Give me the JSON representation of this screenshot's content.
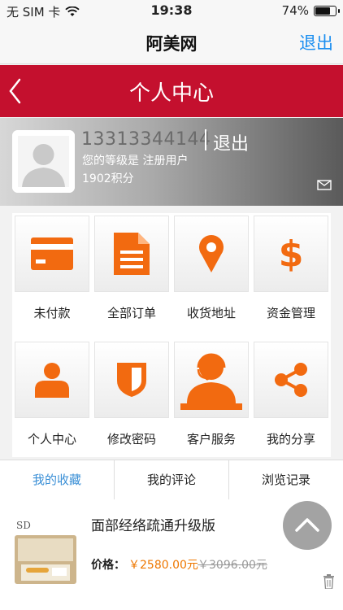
{
  "status_bar": {
    "carrier": "无 SIM 卡",
    "wifi_icon": "wifi-icon",
    "time": "19:38",
    "battery_percent": "74%",
    "battery_level": 0.74
  },
  "nav": {
    "title": "阿美网",
    "logout": "退出"
  },
  "header": {
    "back_icon": "chevron-left-icon",
    "title": "个人中心"
  },
  "profile": {
    "phone": "13313344144",
    "logout": "退出",
    "level": "您的等级是 注册用户",
    "points": "1902积分",
    "mail_icon": "mail-icon"
  },
  "menu": [
    {
      "label": "未付款",
      "icon": "card-icon"
    },
    {
      "label": "全部订单",
      "icon": "document-icon"
    },
    {
      "label": "收货地址",
      "icon": "location-pin-icon"
    },
    {
      "label": "资金管理",
      "icon": "dollar-icon"
    },
    {
      "label": "个人中心",
      "icon": "user-icon"
    },
    {
      "label": "修改密码",
      "icon": "shield-icon"
    },
    {
      "label": "客户服务",
      "icon": "headset-icon"
    },
    {
      "label": "我的分享",
      "icon": "share-icon"
    }
  ],
  "tabs": [
    {
      "label": "我的收藏",
      "active": true
    },
    {
      "label": "我的评论",
      "active": false
    },
    {
      "label": "浏览记录",
      "active": false
    }
  ],
  "product": {
    "name": "面部经络疏通升级版",
    "price_label": "价格：",
    "price": "￥2580.00元",
    "old_price": "￥3096.00元",
    "thumb_text": "SD"
  },
  "colors": {
    "brand_red": "#c4102e",
    "accent_orange": "#f26a10",
    "link_blue": "#1a8ef0",
    "tab_active": "#3a8fd6"
  }
}
